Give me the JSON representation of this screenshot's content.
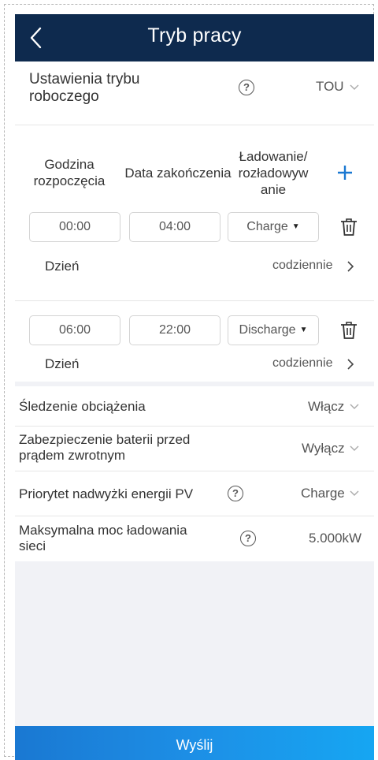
{
  "header": {
    "title": "Tryb pracy"
  },
  "work_mode": {
    "label_line1": "Ustawienia trybu",
    "label_line2": "roboczego",
    "value": "TOU"
  },
  "columns": {
    "start_line1": "Godzina",
    "start_line2": "rozpoczęcia",
    "end": "Data zakończenia",
    "mode_line1": "Ładowanie/",
    "mode_line2": "rozładowyw",
    "mode_line3": "anie"
  },
  "schedules": [
    {
      "start": "00:00",
      "end": "04:00",
      "mode": "Charge",
      "day_label": "Dzień",
      "day_value": "codziennie"
    },
    {
      "start": "06:00",
      "end": "22:00",
      "mode": "Discharge",
      "day_label": "Dzień",
      "day_value": "codziennie"
    }
  ],
  "settings": {
    "load_tracking": {
      "label": "Śledzenie obciążenia",
      "value": "Włącz"
    },
    "reverse_protection": {
      "label_line1": "Zabezpieczenie baterii przed",
      "label_line2": "prądem zwrotnym",
      "value": "Wyłącz"
    },
    "pv_priority": {
      "label": "Priorytet nadwyżki energii PV",
      "value": "Charge"
    },
    "grid_charge": {
      "label_line1": "Maksymalna moc ładowania",
      "label_line2": "sieci",
      "value": "5.000kW"
    }
  },
  "submit": {
    "label": "Wyślij"
  },
  "icons": {
    "back": "back-icon",
    "help": "help-icon",
    "plus": "plus-icon",
    "trash": "trash-icon",
    "chevron": "chevron-down-icon"
  },
  "colors": {
    "header_bg": "#0e2a4e",
    "accent": "#1a78d2",
    "page_bg": "#f1f2f6"
  }
}
